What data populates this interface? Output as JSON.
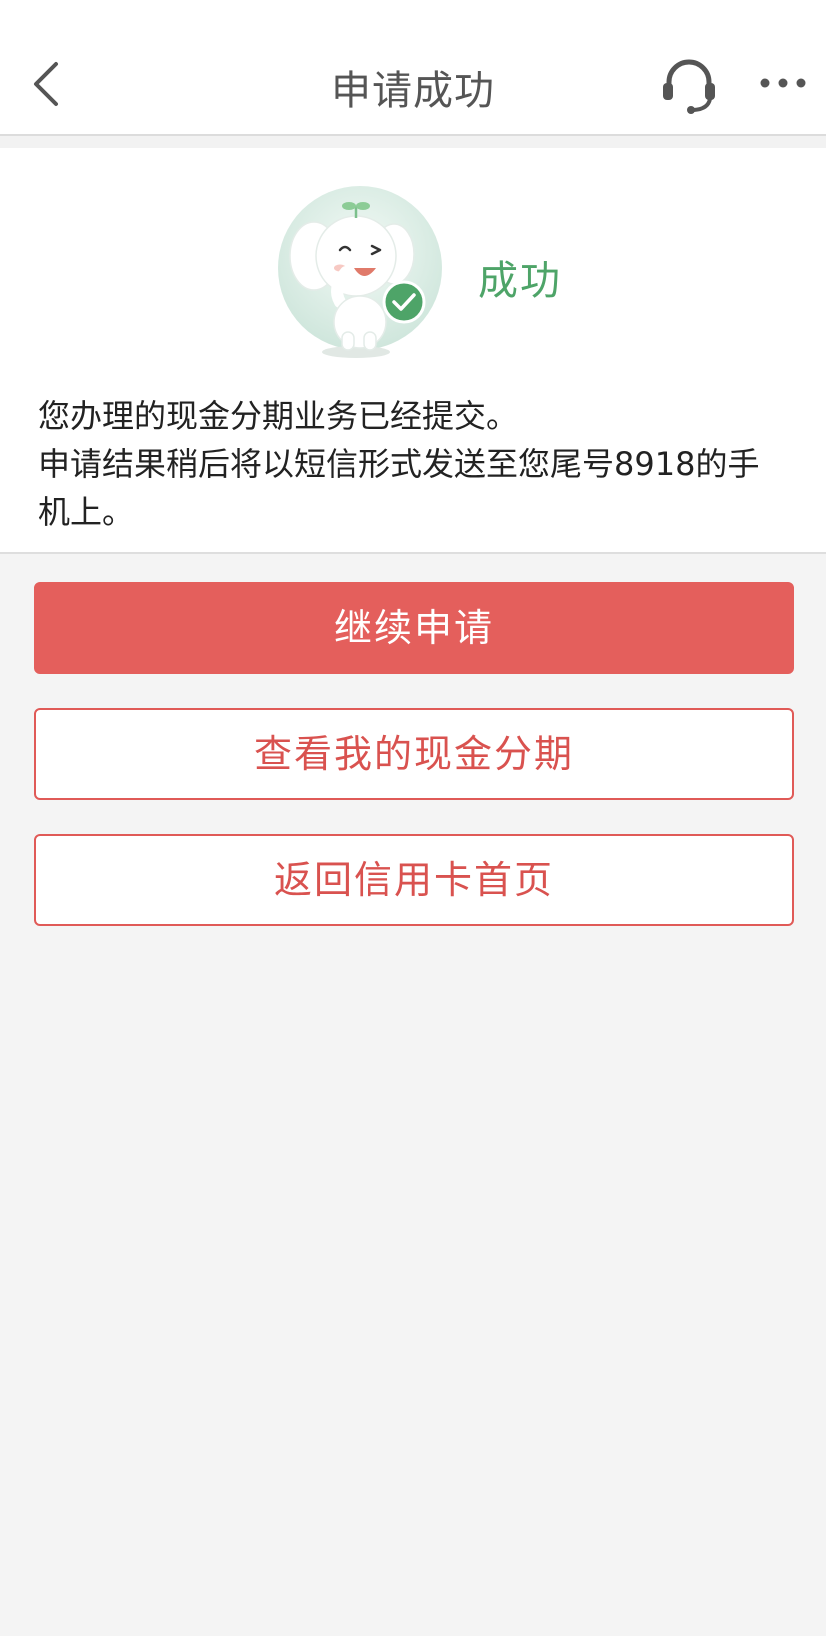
{
  "header": {
    "title": "申请成功"
  },
  "result": {
    "status": "成功",
    "message_lines": [
      "您办理的现金分期业务已经提交。",
      "申请结果稍后将以短信形式发送至您尾号8918的手",
      "机上。"
    ]
  },
  "actions": {
    "continue_label": "继续申请",
    "view_label": "查看我的现金分期",
    "home_label": "返回信用卡首页"
  },
  "icons": {
    "back": "back-icon",
    "service": "headset-icon",
    "more": "more-icon",
    "mascot": "elephant-mascot-icon",
    "check": "check-icon"
  },
  "colors": {
    "primary": "#e45f5c",
    "success": "#4ea468",
    "background": "#f4f4f4"
  }
}
